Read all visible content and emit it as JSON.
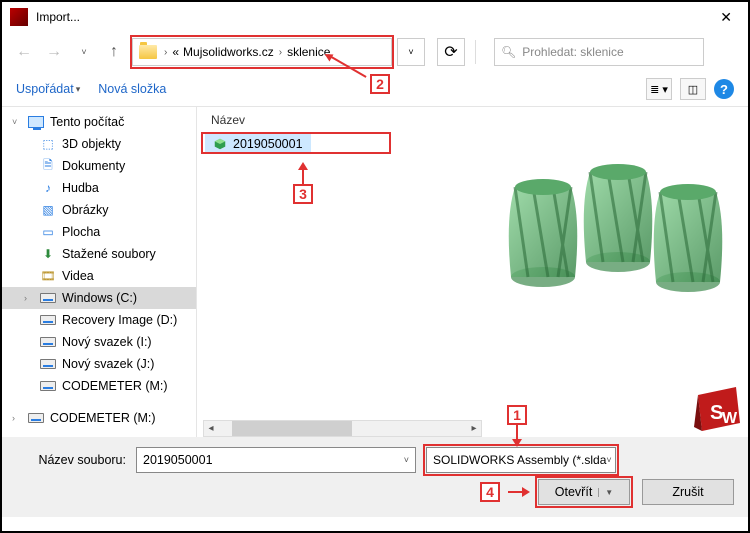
{
  "window": {
    "title": "Import..."
  },
  "breadcrumb": {
    "seg1": "Mujsolidworks.cz",
    "seg2": "sklenice"
  },
  "search": {
    "placeholder": "Prohledat: sklenice"
  },
  "toolbar": {
    "organize": "Uspořádat",
    "new_folder": "Nová složka"
  },
  "tree": {
    "root": "Tento počítač",
    "items": [
      "3D objekty",
      "Dokumenty",
      "Hudba",
      "Obrázky",
      "Plocha",
      "Stažené soubory",
      "Videa",
      "Windows (C:)",
      "Recovery Image (D:)",
      "Nový svazek (I:)",
      "Nový svazek (J:)",
      "CODEMETER (M:)"
    ],
    "root2": "CODEMETER (M:)"
  },
  "files": {
    "column_name": "Název",
    "items": [
      "2019050001"
    ]
  },
  "bottom": {
    "filename_label": "Název souboru:",
    "filename_value": "2019050001",
    "filetype_value": "SOLIDWORKS Assembly (*.slda",
    "open": "Otevřít",
    "cancel": "Zrušit"
  },
  "callouts": {
    "c1": "1",
    "c2": "2",
    "c3": "3",
    "c4": "4"
  }
}
